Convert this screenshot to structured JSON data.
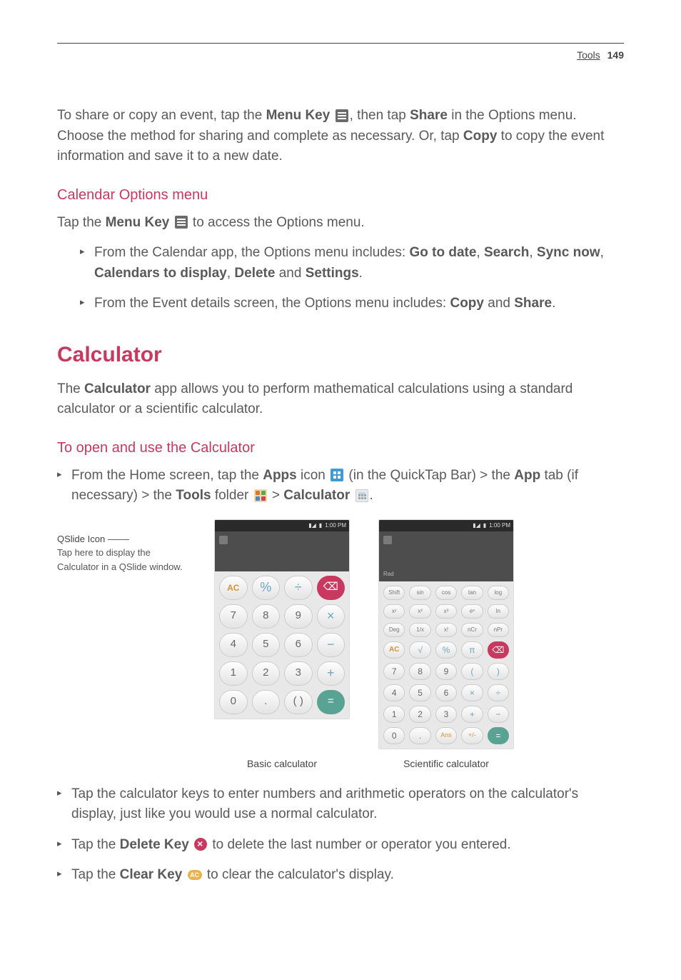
{
  "header": {
    "section": "Tools",
    "page": "149"
  },
  "para1": {
    "t1": "To share or copy an event, tap the ",
    "b1": "Menu Key ",
    "t2": ", then tap ",
    "b2": "Share",
    "t3": " in the Options menu. Choose the method for sharing and complete as necessary. Or, tap ",
    "b3": "Copy",
    "t4": " to copy the event information and save it to a new date."
  },
  "h_cal_opts": "Calendar Options menu",
  "para2": {
    "t1": "Tap the ",
    "b1": "Menu Key ",
    "t2": " to access the Options menu."
  },
  "opt1": {
    "t1": "From the Calendar app, the Options menu includes: ",
    "b1": "Go to date",
    "c1": ", ",
    "b2": "Search",
    "c2": ", ",
    "b3": "Sync now",
    "c3": ", ",
    "b4": "Calendars to display",
    "c4": ", ",
    "b5": "Delete",
    "c5": " and ",
    "b6": "Settings",
    "c6": "."
  },
  "opt2": {
    "t1": "From the Event details screen, the Options menu includes: ",
    "b1": "Copy",
    "c1": " and ",
    "b2": "Share",
    "c2": "."
  },
  "h_calc": "Calculator",
  "para3": {
    "t1": "The ",
    "b1": "Calculator",
    "t2": " app allows you to perform mathematical calculations using a standard calculator or a scientific calculator."
  },
  "h_open": "To open and use the Calculator",
  "open1": {
    "t1": "From the Home screen, tap the ",
    "b1": "Apps",
    "t2": " icon ",
    "t3": " (in the QuickTap Bar) > the ",
    "b2": "App",
    "t4": " tab (if necessary) > the ",
    "b3": "Tools",
    "t5": " folder ",
    "t6": " > ",
    "b4": "Calculator",
    "t7": " ",
    "t8": "."
  },
  "callout": {
    "title": "QSlide Icon",
    "body": "Tap here to display the Calculator in a QSlide window."
  },
  "statusbar_time": "1:00 PM",
  "basic": {
    "r1": [
      "AC",
      "%",
      "÷",
      "⌫"
    ],
    "r2": [
      "7",
      "8",
      "9",
      "×"
    ],
    "r3": [
      "4",
      "5",
      "6",
      "−"
    ],
    "r4": [
      "1",
      "2",
      "3",
      "+"
    ],
    "r5": [
      "0",
      ".",
      "( )",
      "="
    ]
  },
  "sci": {
    "rad": "Rad",
    "s1": [
      "Shift",
      "sin",
      "cos",
      "tan",
      "log"
    ],
    "s2": [
      "xʸ",
      "x²",
      "x³",
      "eˣ",
      "ln"
    ],
    "s3": [
      "Deg",
      "1/x",
      "x!",
      "nCr",
      "nPr"
    ],
    "r1": [
      "AC",
      "√",
      "%",
      "π",
      "⌫"
    ],
    "r2": [
      "7",
      "8",
      "9",
      "(",
      ")"
    ],
    "r3": [
      "4",
      "5",
      "6",
      "×",
      "÷"
    ],
    "r4": [
      "1",
      "2",
      "3",
      "+",
      "−"
    ],
    "r5": [
      "0",
      ".",
      "Ans",
      "+/-",
      "="
    ]
  },
  "captions": {
    "basic": "Basic calculator",
    "sci": "Scientific calculator"
  },
  "tap_keys": "Tap the calculator keys to enter numbers and arithmetic operators on the calculator's display, just like you would use a normal calculator.",
  "tap_del": {
    "t1": "Tap the ",
    "b1": "Delete Key ",
    "t2": " to delete the last number or operator you entered."
  },
  "tap_clr": {
    "t1": "Tap the ",
    "b1": "Clear Key ",
    "t2": " to clear the calculator's display."
  }
}
